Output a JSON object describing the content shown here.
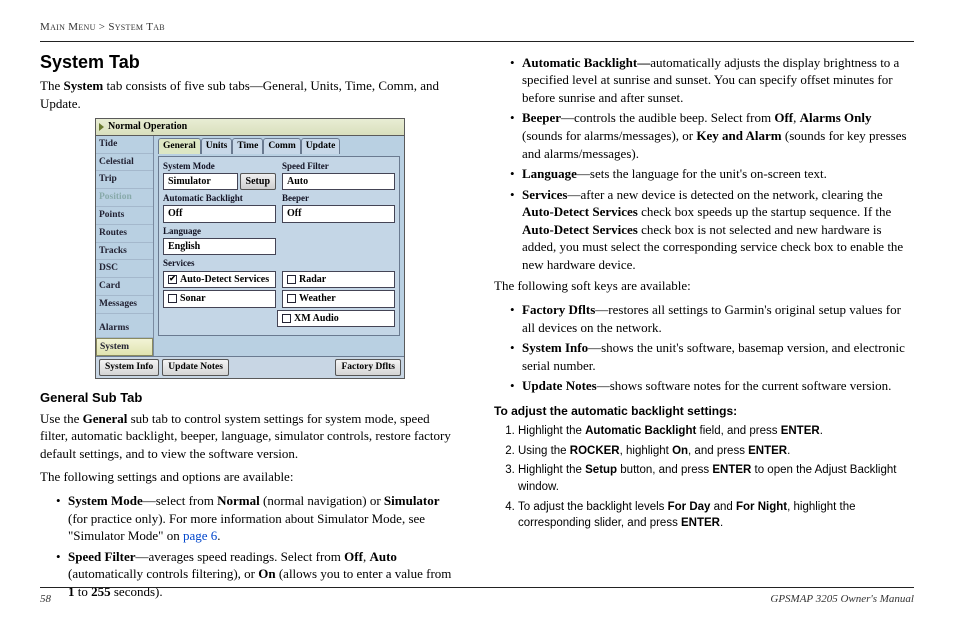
{
  "breadcrumb": {
    "a": "Main Menu",
    "sep": ">",
    "b": "System Tab"
  },
  "title": "System Tab",
  "intro": {
    "pre": "The ",
    "b1": "System",
    "post": " tab consists of five sub tabs—General, Units, Time, Comm, and Update."
  },
  "device": {
    "title": "Normal Operation",
    "side": [
      "Tide",
      "Celestial",
      "Trip",
      "Position",
      "Points",
      "Routes",
      "Tracks",
      "DSC",
      "Card",
      "Messages"
    ],
    "side2": [
      "Alarms",
      "System"
    ],
    "tabs": [
      "General",
      "Units",
      "Time",
      "Comm",
      "Update"
    ],
    "labels": {
      "sysmode": "System Mode",
      "speed": "Speed Filter",
      "autob": "Automatic Backlight",
      "beeper": "Beeper",
      "lang": "Language",
      "services": "Services"
    },
    "vals": {
      "sysmode": "Simulator",
      "setup": "Setup",
      "speed": "Auto",
      "autob": "Off",
      "beeper": "Off",
      "lang": "English",
      "cb_auto": "Auto-Detect Services",
      "cb_sonar": "Sonar",
      "cb_radar": "Radar",
      "cb_weather": "Weather",
      "cb_xm": "XM Audio"
    },
    "soft": {
      "left1": "System Info",
      "left2": "Update Notes",
      "right": "Factory Dflts"
    }
  },
  "sub1_head": "General Sub Tab",
  "sub1_p": {
    "pre": "Use the ",
    "b": "General",
    "post": " sub tab to control system settings for system mode, speed filter, automatic backlight, beeper, language, simulator controls, restore factory default settings, and to view the software version."
  },
  "avail": "The following settings and options are available:",
  "left_bullets": {
    "b1": {
      "h": "System Mode",
      "t1": "—select from ",
      "b2": "Normal",
      "t2": " (normal navigation) or ",
      "b3": "Simulator",
      "t3": " (for practice only). For more information about Simulator Mode, see \"Simulator Mode\" on ",
      "link": "page 6",
      "t4": "."
    },
    "b2": {
      "h": "Speed Filter",
      "t1": "—averages speed readings. Select from ",
      "b2": "Off",
      "t2": ", ",
      "b3": "Auto",
      "t3": " (automatically controls filtering), or ",
      "b4": "On",
      "t4": " (allows you to enter a value from ",
      "b5": "1",
      "t5": " to ",
      "b6": "255",
      "t6": " seconds)."
    }
  },
  "right_bullets": {
    "r1": {
      "h": "Automatic Backlight—",
      "t": "automatically adjusts the display brightness to a specified level at sunrise and sunset. You can specify offset minutes for before sunrise and after sunset."
    },
    "r2": {
      "h": "Beeper",
      "t1": "—controls the audible beep. Select from ",
      "b2": "Off",
      "t2": ", ",
      "b3": "Alarms Only",
      "t3": " (sounds for alarms/messages), or ",
      "b4": "Key and Alarm",
      "t4": " (sounds for key presses and alarms/messages)."
    },
    "r3": {
      "h": "Language",
      "t": "—sets the language for the unit's on-screen text."
    },
    "r4": {
      "h": "Services",
      "t1": "—after a new device is detected on the network, clearing the ",
      "b2": "Auto-Detect Services",
      "t2": " check box speeds up the startup sequence. If the ",
      "b3": "Auto-Detect Services",
      "t3": " check box is not selected and new hardware is added, you must select the corresponding service check box to enable the new hardware device."
    }
  },
  "softkeys_intro": "The following soft keys are available:",
  "soft_bullets": {
    "s1": {
      "h": "Factory Dflts",
      "t": "—restores all settings to Garmin's original setup values for all devices on the network."
    },
    "s2": {
      "h": "System Info",
      "t": "—shows the unit's software, basemap version, and electronic serial number."
    },
    "s3": {
      "h": "Update Notes",
      "t": "—shows software notes for the current software version."
    }
  },
  "proc_head": "To adjust the automatic backlight settings:",
  "steps": {
    "s1": {
      "t1": "Highlight the ",
      "b1": "Automatic Backlight",
      "t2": " field, and press ",
      "b2": "ENTER",
      "t3": "."
    },
    "s2": {
      "t1": "Using the ",
      "b1": "ROCKER",
      "t2": ", highlight ",
      "b2": "On",
      "t3": ", and press ",
      "b3": "ENTER",
      "t4": "."
    },
    "s3": {
      "t1": "Highlight the ",
      "b1": "Setup",
      "t2": " button, and press ",
      "b2": "ENTER",
      "t3": " to open the Adjust Backlight window."
    },
    "s4": {
      "t1": "To adjust the backlight levels ",
      "b1": "For Day",
      "t2": " and ",
      "b2": "For Night",
      "t3": ", highlight the corresponding slider, and press ",
      "b3": "ENTER",
      "t4": "."
    }
  },
  "footer": {
    "page": "58",
    "doc": "GPSMAP 3205 Owner's Manual"
  }
}
